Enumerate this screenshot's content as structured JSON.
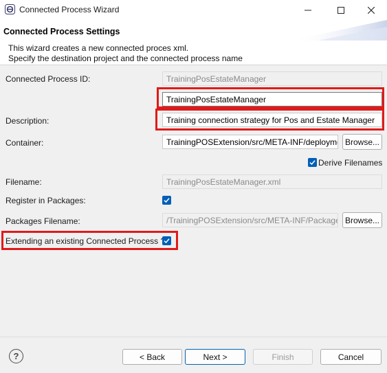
{
  "window": {
    "title": "Connected Process Wizard",
    "minimize_icon": "minimize-icon",
    "maximize_icon": "maximize-icon",
    "close_icon": "close-icon"
  },
  "header": {
    "title": "Connected Process Settings",
    "message_line1": "This wizard creates a new connected proces xml.",
    "message_line2": "Specify the destination project and the connected process name"
  },
  "form": {
    "process_id_label": "Connected Process ID:",
    "process_id_value": "TrainingPosEstateManager",
    "process_id_input": "TrainingPosEstateManager",
    "description_label": "Description:",
    "description_value": "Training connection strategy for Pos and Estate Manager",
    "container_label": "Container:",
    "container_value": "TrainingPOSExtension/src/META-INF/deployme",
    "container_browse": "Browse...",
    "derive_filenames_label": "Derive Filenames",
    "derive_filenames_checked": true,
    "filename_label": "Filename:",
    "filename_value": "TrainingPosEstateManager.xml",
    "register_label": "Register in Packages:",
    "register_checked": true,
    "packages_filename_label": "Packages Filename:",
    "packages_filename_value": "/TrainingPOSExtension/src/META-INF/Package",
    "packages_browse": "Browse...",
    "extending_label": "Extending an existing Connected Process ?",
    "extending_checked": true
  },
  "footer": {
    "help_icon": "help-icon",
    "help_glyph": "?",
    "back": "< Back",
    "next": "Next >",
    "finish": "Finish",
    "cancel": "Cancel"
  },
  "colors": {
    "highlight": "#e01a1a",
    "checkbox": "#005fb8"
  }
}
